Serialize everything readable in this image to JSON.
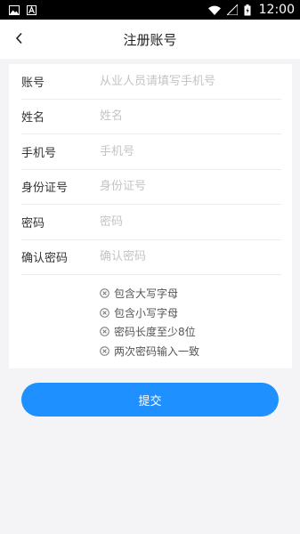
{
  "statusbar": {
    "time": "12:00",
    "icons": [
      "image-icon",
      "a-icon",
      "wifi-icon",
      "signal-icon",
      "battery-icon"
    ]
  },
  "header": {
    "title": "注册账号",
    "back_icon": "back-arrow-icon"
  },
  "form": {
    "fields": [
      {
        "label": "账号",
        "placeholder": "从业人员请填写手机号",
        "value": ""
      },
      {
        "label": "姓名",
        "placeholder": "姓名",
        "value": ""
      },
      {
        "label": "手机号",
        "placeholder": "手机号",
        "value": ""
      },
      {
        "label": "身份证号",
        "placeholder": "身份证号",
        "value": ""
      },
      {
        "label": "密码",
        "placeholder": "密码",
        "value": ""
      },
      {
        "label": "确认密码",
        "placeholder": "确认密码",
        "value": ""
      }
    ],
    "password_rules": [
      {
        "text": "包含大写字母",
        "icon": "x-circle-icon"
      },
      {
        "text": "包含小写字母",
        "icon": "x-circle-icon"
      },
      {
        "text": "密码长度至少8位",
        "icon": "x-circle-icon"
      },
      {
        "text": "两次密码输入一致",
        "icon": "x-circle-icon"
      }
    ]
  },
  "submit": {
    "label": "提交"
  },
  "colors": {
    "accent": "#1e90ff",
    "background": "#f4f4f6"
  }
}
